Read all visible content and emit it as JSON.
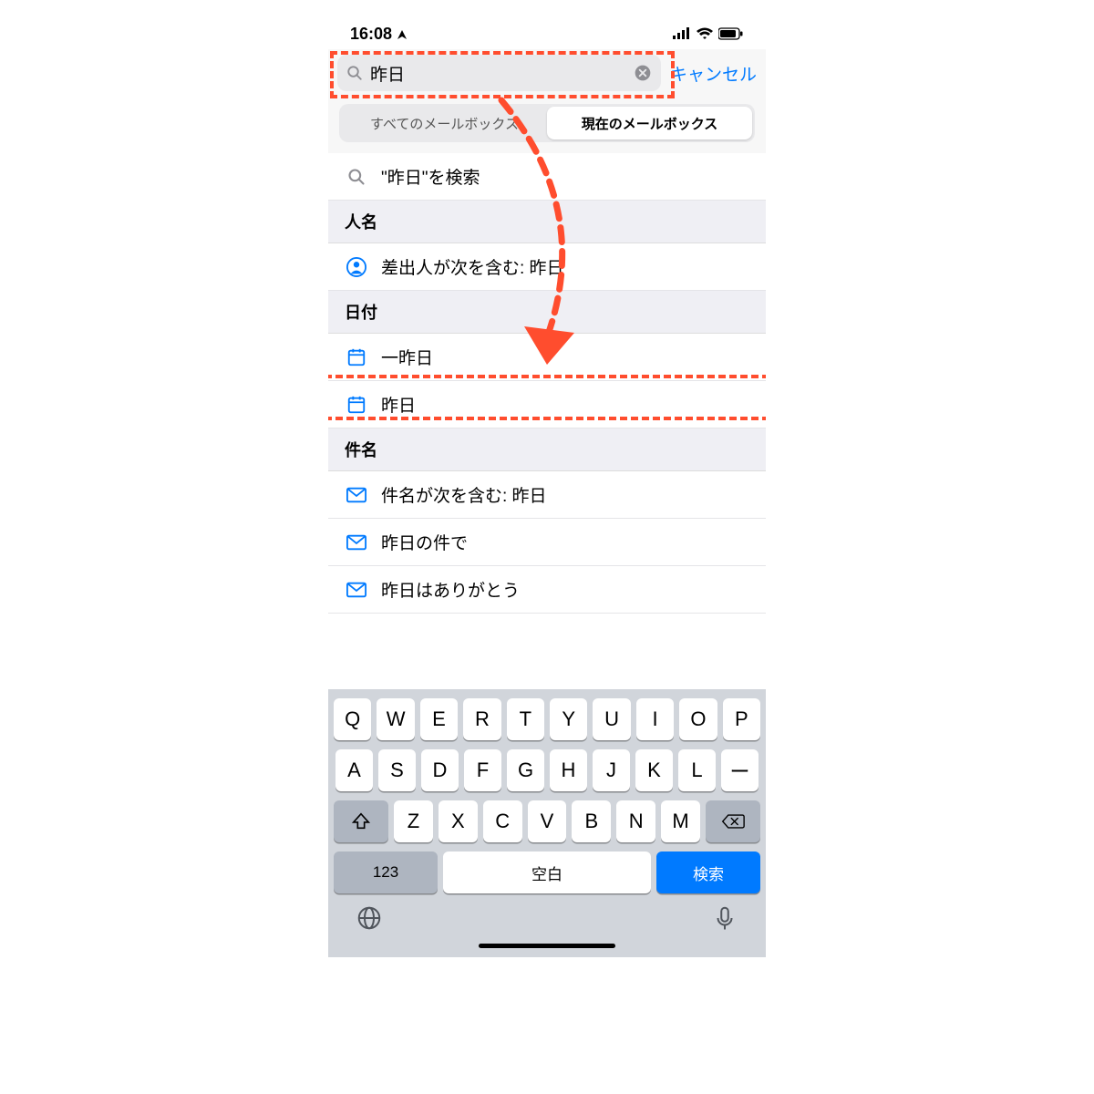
{
  "status": {
    "time": "16:08"
  },
  "search": {
    "value": "昨日"
  },
  "cancel_label": "キャンセル",
  "segmented": {
    "all": "すべてのメールボックス",
    "current": "現在のメールボックス"
  },
  "rows": {
    "search_for": "\"昨日\"を検索",
    "section_people": "人名",
    "people_row": "差出人が次を含む: 昨日",
    "section_date": "日付",
    "date_row1": "一昨日",
    "date_row2": "昨日",
    "section_subject": "件名",
    "subj_row1": "件名が次を含む: 昨日",
    "subj_row2": "昨日の件で",
    "subj_row3": "昨日はありがとう"
  },
  "keyboard": {
    "row1": [
      "Q",
      "W",
      "E",
      "R",
      "T",
      "Y",
      "U",
      "I",
      "O",
      "P"
    ],
    "row2": [
      "A",
      "S",
      "D",
      "F",
      "G",
      "H",
      "J",
      "K",
      "L",
      "ー"
    ],
    "row3": [
      "Z",
      "X",
      "C",
      "V",
      "B",
      "N",
      "M"
    ],
    "num": "123",
    "space": "空白",
    "ret": "検索"
  }
}
